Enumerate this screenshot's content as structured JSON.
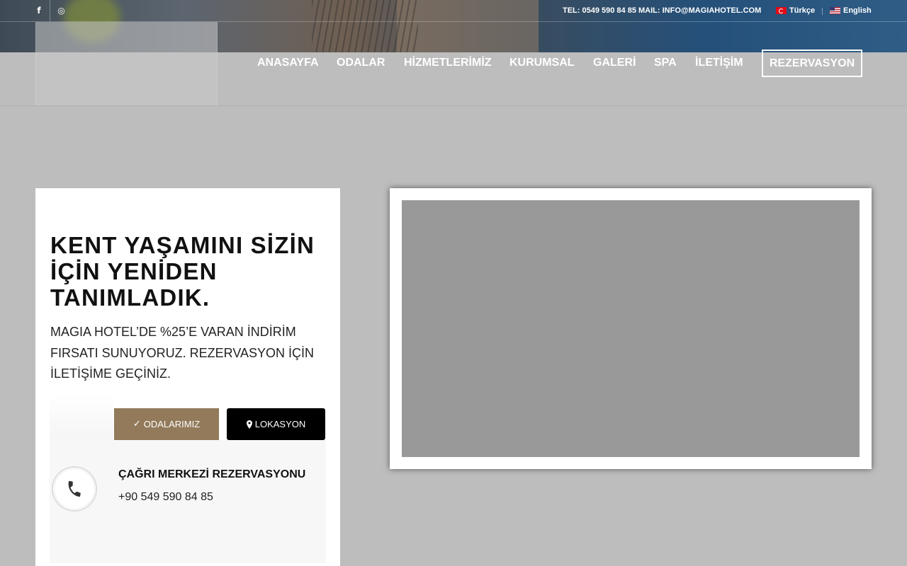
{
  "topbar": {
    "social": [
      {
        "name": "facebook-icon",
        "glyph": "f"
      },
      {
        "name": "instagram-icon",
        "glyph": "◎"
      }
    ],
    "contact": "TEL: 0549 590 84 85 MAIL: INFO@MAGIAHOTEL.COM",
    "languages": [
      {
        "label": "Türkçe",
        "flag": "flag-tr-icon"
      },
      {
        "label": "English",
        "flag": "flag-us-icon"
      }
    ]
  },
  "nav": {
    "items": [
      "ANASAYFA",
      "ODALAR",
      "HİZMETLERİMİZ",
      "KURUMSAL",
      "GALERİ",
      "SPA",
      "İLETİŞİM"
    ],
    "reserve": "REZERVASYON"
  },
  "hero": {
    "heading": "KENT YAŞAMINI SİZİN İÇİN YENİDEN TANIMLADIK.",
    "text": "MAGIA HOTEL’DE %25’E VARAN İNDİRİM FIRSATI SUNUYORUZ. REZERVASYON İÇİN İLETİŞİME GEÇİNİZ.",
    "btn_rooms": "ODALARIMIZ",
    "btn_location": "LOKASYON"
  },
  "call": {
    "title": "ÇAĞRI MERKEZİ REZERVASYONU",
    "phone": "+90 549 590 84 85"
  },
  "colors": {
    "accent": "#927a5a",
    "background": "#bdbdbd",
    "media_placeholder": "#999999"
  }
}
